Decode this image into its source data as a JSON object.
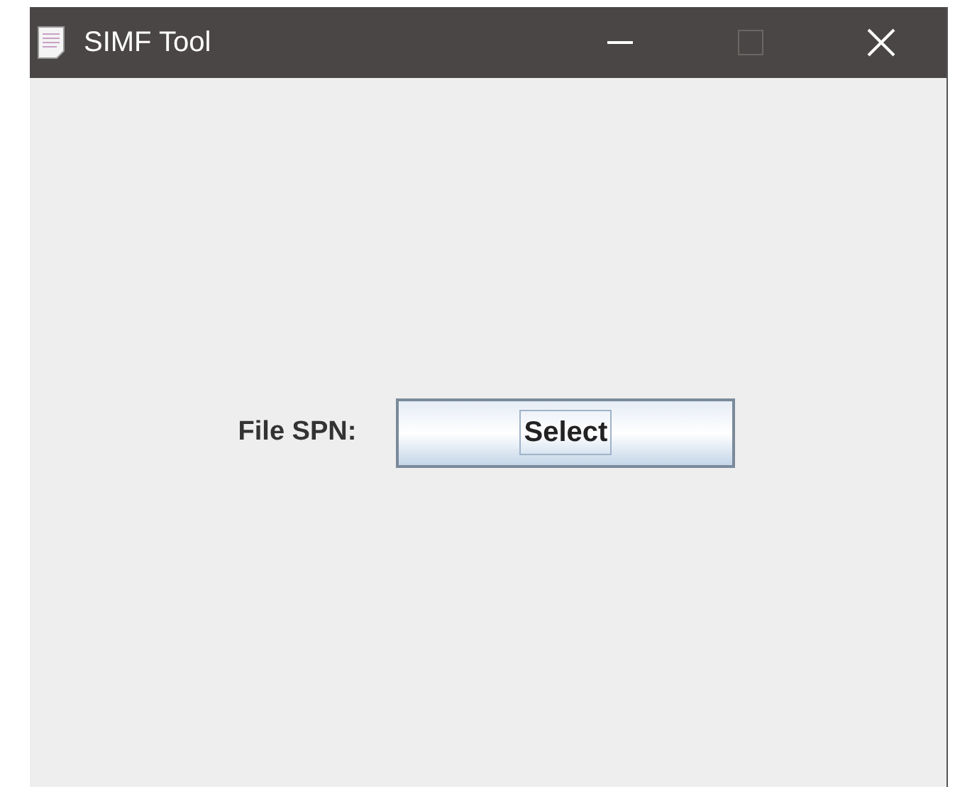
{
  "window": {
    "title": "SIMF Tool",
    "maximize_disabled": true
  },
  "form": {
    "label": "File SPN:",
    "button": {
      "label": "Select",
      "focused": true
    }
  }
}
